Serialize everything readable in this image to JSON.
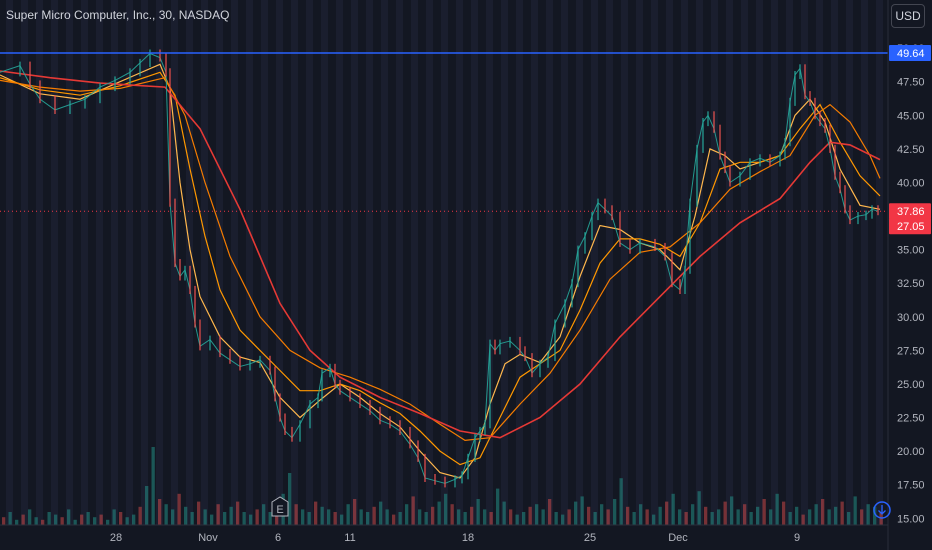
{
  "header": {
    "title": "Super Micro Computer, Inc., 30, NASDAQ",
    "currency": "USD"
  },
  "colors": {
    "background": "#131722",
    "band": "#1c2030",
    "grid": "#2a2e39",
    "up": "#26a69a",
    "down": "#ef5350",
    "resistance": "#2962ff",
    "ma_fast": "#ffb74d",
    "ma_mid": "#ff9800",
    "ma_slow": "#f57c00",
    "ma_long": "#e53935",
    "price_tag": "#f23645",
    "last_price_tag": "#2962ff"
  },
  "chart_data": {
    "type": "line",
    "title": "Super Micro Computer, Inc., 30, NASDAQ",
    "xlabel": "",
    "ylabel": "",
    "x_tick_labels": [
      "28",
      "Nov",
      "6",
      "11",
      "18",
      "25",
      "Dec",
      "9"
    ],
    "y_tick_labels": [
      "15.00",
      "17.50",
      "20.00",
      "22.50",
      "25.00",
      "27.50",
      "30.00",
      "32.50",
      "35.00",
      "37.50",
      "40.00",
      "42.50",
      "45.00",
      "47.50",
      "50.00"
    ],
    "ylim": [
      14.5,
      51.5
    ],
    "grid": false,
    "horizontal_line": {
      "value": 49.64,
      "label": "49.64"
    },
    "price_labels": {
      "current": "37.86",
      "countdown": "27.05"
    },
    "series": [
      {
        "name": "",
        "role": "price",
        "points": [
          [
            0,
            48.2
          ],
          [
            20,
            48.7
          ],
          [
            30,
            47.3
          ],
          [
            40,
            46.2
          ],
          [
            55,
            45.4
          ],
          [
            70,
            45.8
          ],
          [
            85,
            46.2
          ],
          [
            100,
            47.1
          ],
          [
            115,
            47.6
          ],
          [
            130,
            48.2
          ],
          [
            140,
            48.9
          ],
          [
            150,
            49.6
          ],
          [
            160,
            49.3
          ],
          [
            166,
            48.2
          ],
          [
            170,
            38.5
          ],
          [
            175,
            34.0
          ],
          [
            180,
            33.0
          ],
          [
            185,
            33.5
          ],
          [
            190,
            32.0
          ],
          [
            195,
            29.5
          ],
          [
            200,
            27.8
          ],
          [
            210,
            28.3
          ],
          [
            220,
            27.3
          ],
          [
            230,
            26.8
          ],
          [
            240,
            26.3
          ],
          [
            250,
            26.5
          ],
          [
            260,
            26.8
          ],
          [
            270,
            26.0
          ],
          [
            275,
            24.0
          ],
          [
            280,
            22.5
          ],
          [
            285,
            21.5
          ],
          [
            292,
            21.0
          ],
          [
            300,
            22.0
          ],
          [
            310,
            23.5
          ],
          [
            318,
            24.0
          ],
          [
            322,
            25.8
          ],
          [
            330,
            26.2
          ],
          [
            335,
            25.0
          ],
          [
            340,
            24.5
          ],
          [
            350,
            24.0
          ],
          [
            360,
            23.5
          ],
          [
            370,
            23.0
          ],
          [
            380,
            22.3
          ],
          [
            390,
            22.0
          ],
          [
            400,
            21.5
          ],
          [
            410,
            20.5
          ],
          [
            418,
            19.5
          ],
          [
            425,
            18.0
          ],
          [
            435,
            17.8
          ],
          [
            445,
            17.6
          ],
          [
            455,
            17.9
          ],
          [
            462,
            18.2
          ],
          [
            468,
            19.5
          ],
          [
            475,
            21.0
          ],
          [
            480,
            21.5
          ],
          [
            485,
            22.0
          ],
          [
            490,
            28.0
          ],
          [
            495,
            27.5
          ],
          [
            500,
            28.0
          ],
          [
            510,
            28.2
          ],
          [
            520,
            27.5
          ],
          [
            525,
            27.0
          ],
          [
            532,
            25.8
          ],
          [
            540,
            26.5
          ],
          [
            548,
            27.0
          ],
          [
            555,
            29.5
          ],
          [
            565,
            31.0
          ],
          [
            572,
            32.5
          ],
          [
            578,
            35.0
          ],
          [
            585,
            36.0
          ],
          [
            592,
            37.5
          ],
          [
            598,
            38.5
          ],
          [
            605,
            38.0
          ],
          [
            612,
            37.5
          ],
          [
            620,
            35.5
          ],
          [
            630,
            35.0
          ],
          [
            640,
            35.5
          ],
          [
            655,
            35.2
          ],
          [
            665,
            34.5
          ],
          [
            672,
            32.5
          ],
          [
            680,
            32.0
          ],
          [
            685,
            33.5
          ],
          [
            690,
            38.5
          ],
          [
            697,
            42.5
          ],
          [
            703,
            44.5
          ],
          [
            708,
            45.0
          ],
          [
            714,
            44.0
          ],
          [
            720,
            42.0
          ],
          [
            725,
            41.0
          ],
          [
            730,
            40.0
          ],
          [
            740,
            40.5
          ],
          [
            750,
            41.5
          ],
          [
            760,
            41.8
          ],
          [
            770,
            41.5
          ],
          [
            780,
            42.0
          ],
          [
            785,
            43.0
          ],
          [
            790,
            46.0
          ],
          [
            795,
            48.0
          ],
          [
            800,
            48.5
          ],
          [
            805,
            46.5
          ],
          [
            810,
            46.0
          ],
          [
            815,
            45.0
          ],
          [
            820,
            44.5
          ],
          [
            825,
            44.0
          ],
          [
            830,
            42.5
          ],
          [
            835,
            40.5
          ],
          [
            840,
            39.5
          ],
          [
            845,
            38.0
          ],
          [
            850,
            37.2
          ],
          [
            858,
            37.5
          ],
          [
            866,
            37.6
          ],
          [
            872,
            38.0
          ],
          [
            878,
            37.86
          ]
        ]
      },
      {
        "name": "",
        "role": "ma-fast",
        "points": [
          [
            0,
            48.0
          ],
          [
            40,
            46.6
          ],
          [
            80,
            46.2
          ],
          [
            120,
            47.5
          ],
          [
            160,
            48.8
          ],
          [
            170,
            47.0
          ],
          [
            180,
            40.0
          ],
          [
            190,
            35.0
          ],
          [
            200,
            31.5
          ],
          [
            220,
            28.5
          ],
          [
            240,
            27.0
          ],
          [
            260,
            26.6
          ],
          [
            280,
            24.0
          ],
          [
            300,
            22.5
          ],
          [
            320,
            23.8
          ],
          [
            340,
            25.0
          ],
          [
            360,
            24.0
          ],
          [
            380,
            22.8
          ],
          [
            400,
            21.8
          ],
          [
            420,
            20.0
          ],
          [
            440,
            18.4
          ],
          [
            460,
            18.0
          ],
          [
            475,
            19.5
          ],
          [
            490,
            23.5
          ],
          [
            505,
            26.5
          ],
          [
            520,
            27.2
          ],
          [
            540,
            26.6
          ],
          [
            560,
            28.5
          ],
          [
            580,
            33.0
          ],
          [
            600,
            36.8
          ],
          [
            620,
            36.5
          ],
          [
            640,
            35.5
          ],
          [
            660,
            35.0
          ],
          [
            680,
            33.5
          ],
          [
            695,
            37.5
          ],
          [
            710,
            42.5
          ],
          [
            725,
            42.0
          ],
          [
            740,
            41.0
          ],
          [
            760,
            41.5
          ],
          [
            780,
            42.0
          ],
          [
            795,
            45.0
          ],
          [
            810,
            46.2
          ],
          [
            825,
            44.5
          ],
          [
            840,
            41.0
          ],
          [
            860,
            38.3
          ],
          [
            880,
            38.0
          ]
        ]
      },
      {
        "name": "",
        "role": "ma-mid",
        "points": [
          [
            0,
            47.8
          ],
          [
            40,
            46.9
          ],
          [
            80,
            46.5
          ],
          [
            120,
            47.2
          ],
          [
            160,
            48.2
          ],
          [
            175,
            46.5
          ],
          [
            190,
            41.0
          ],
          [
            205,
            36.0
          ],
          [
            220,
            32.0
          ],
          [
            240,
            29.0
          ],
          [
            260,
            27.5
          ],
          [
            280,
            26.0
          ],
          [
            300,
            24.5
          ],
          [
            320,
            24.5
          ],
          [
            340,
            25.0
          ],
          [
            360,
            24.5
          ],
          [
            380,
            23.6
          ],
          [
            400,
            22.8
          ],
          [
            420,
            21.5
          ],
          [
            440,
            20.0
          ],
          [
            460,
            19.0
          ],
          [
            480,
            19.5
          ],
          [
            500,
            22.5
          ],
          [
            520,
            25.5
          ],
          [
            540,
            26.5
          ],
          [
            560,
            27.5
          ],
          [
            580,
            30.5
          ],
          [
            600,
            34.0
          ],
          [
            620,
            35.8
          ],
          [
            640,
            35.8
          ],
          [
            660,
            35.4
          ],
          [
            680,
            34.5
          ],
          [
            700,
            37.0
          ],
          [
            720,
            41.0
          ],
          [
            740,
            41.5
          ],
          [
            760,
            41.5
          ],
          [
            780,
            42.0
          ],
          [
            800,
            44.0
          ],
          [
            820,
            45.8
          ],
          [
            840,
            43.0
          ],
          [
            860,
            40.5
          ],
          [
            880,
            39.0
          ]
        ]
      },
      {
        "name": "",
        "role": "ma-slow",
        "points": [
          [
            0,
            47.6
          ],
          [
            40,
            47.1
          ],
          [
            80,
            46.8
          ],
          [
            120,
            47.0
          ],
          [
            165,
            47.8
          ],
          [
            185,
            45.0
          ],
          [
            205,
            40.0
          ],
          [
            230,
            34.5
          ],
          [
            260,
            30.0
          ],
          [
            290,
            27.5
          ],
          [
            320,
            26.2
          ],
          [
            350,
            25.5
          ],
          [
            380,
            24.6
          ],
          [
            410,
            23.5
          ],
          [
            440,
            22.0
          ],
          [
            465,
            20.8
          ],
          [
            490,
            21.0
          ],
          [
            520,
            23.5
          ],
          [
            550,
            25.8
          ],
          [
            580,
            29.0
          ],
          [
            610,
            32.8
          ],
          [
            640,
            34.8
          ],
          [
            670,
            35.2
          ],
          [
            700,
            37.0
          ],
          [
            730,
            39.5
          ],
          [
            760,
            40.8
          ],
          [
            790,
            42.0
          ],
          [
            815,
            45.0
          ],
          [
            830,
            45.8
          ],
          [
            850,
            44.5
          ],
          [
            870,
            42.0
          ],
          [
            880,
            40.3
          ]
        ]
      },
      {
        "name": "",
        "role": "ma-long",
        "points": [
          [
            0,
            48.3
          ],
          [
            50,
            47.8
          ],
          [
            100,
            47.4
          ],
          [
            165,
            47.1
          ],
          [
            200,
            44.0
          ],
          [
            240,
            38.0
          ],
          [
            280,
            31.0
          ],
          [
            310,
            27.5
          ],
          [
            340,
            25.5
          ],
          [
            380,
            24.0
          ],
          [
            420,
            22.8
          ],
          [
            460,
            21.5
          ],
          [
            500,
            21.0
          ],
          [
            540,
            22.5
          ],
          [
            580,
            25.0
          ],
          [
            620,
            28.5
          ],
          [
            660,
            31.5
          ],
          [
            700,
            34.5
          ],
          [
            740,
            37.0
          ],
          [
            780,
            38.8
          ],
          [
            810,
            41.5
          ],
          [
            830,
            43.0
          ],
          [
            850,
            42.8
          ],
          [
            880,
            41.7
          ]
        ]
      }
    ],
    "volume_bars": [
      3,
      5,
      2,
      4,
      6,
      3,
      2,
      5,
      4,
      3,
      6,
      2,
      4,
      5,
      3,
      4,
      2,
      6,
      5,
      3,
      4,
      7,
      15,
      30,
      10,
      8,
      6,
      12,
      7,
      5,
      9,
      6,
      4,
      8,
      5,
      7,
      9,
      5,
      4,
      6,
      8,
      5,
      4,
      12,
      20,
      8,
      6,
      5,
      9,
      7,
      6,
      5,
      4,
      8,
      10,
      6,
      5,
      7,
      9,
      6,
      4,
      5,
      8,
      11,
      6,
      5,
      7,
      9,
      12,
      8,
      6,
      5,
      7,
      10,
      6,
      5,
      14,
      9,
      6,
      4,
      5,
      7,
      8,
      6,
      10,
      5,
      4,
      6,
      9,
      11,
      7,
      5,
      8,
      6,
      10,
      18,
      7,
      5,
      8,
      6,
      4,
      7,
      9,
      12,
      6,
      5,
      8,
      13,
      7,
      5,
      6,
      9,
      11,
      6,
      8,
      5,
      7,
      10,
      6,
      12,
      9,
      5,
      7,
      4,
      6,
      8,
      10,
      6,
      7,
      9,
      5,
      11,
      6,
      8,
      7,
      5
    ]
  }
}
